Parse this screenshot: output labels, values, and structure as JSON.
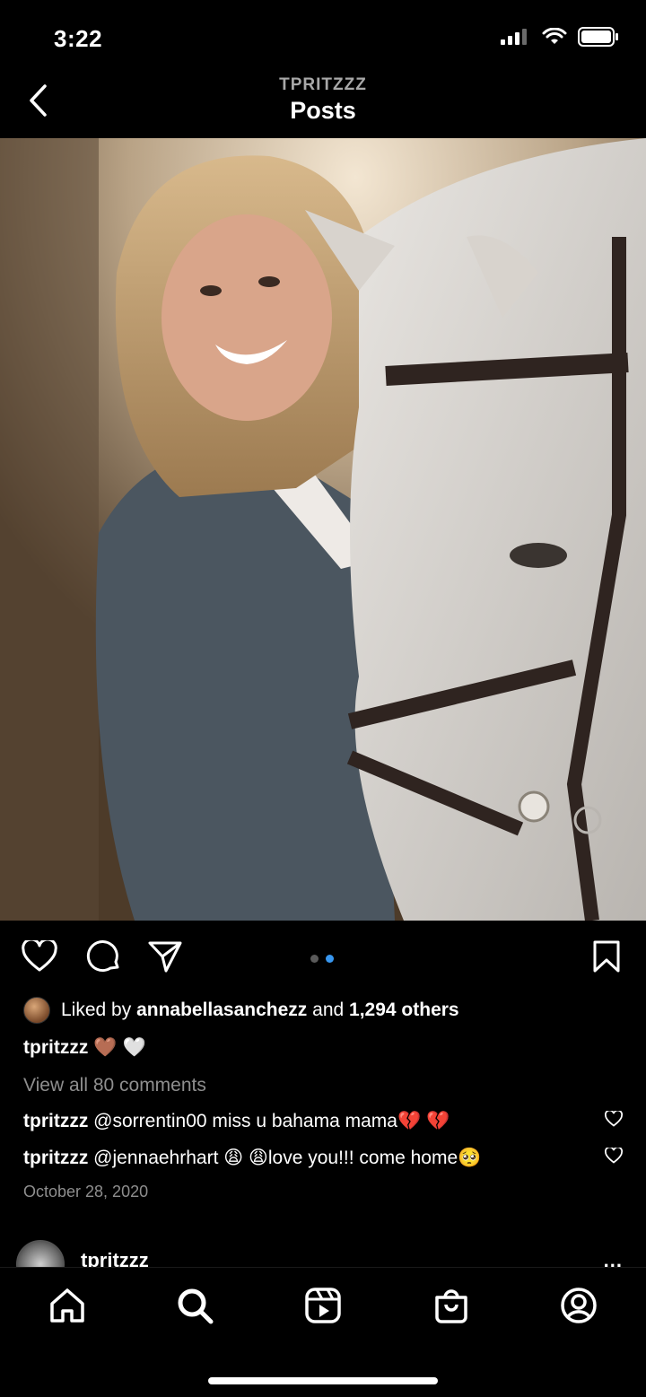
{
  "status_bar": {
    "time": "3:22"
  },
  "header": {
    "username": "TPRITZZZ",
    "title": "Posts"
  },
  "post": {
    "carousel": {
      "count": 2,
      "active_index": 1
    },
    "likes": {
      "prefix": "Liked by",
      "liked_by_user": "annabellasanchezz",
      "and": "and",
      "others": "1,294 others"
    },
    "caption": {
      "username": "tpritzzz",
      "emojis": [
        "🤎",
        "🤍"
      ]
    },
    "view_all_comments": "View all 80 comments",
    "comments": [
      {
        "username": "tpritzzz",
        "text": "@sorrentin00 miss u bahama mama💔 💔"
      },
      {
        "username": "tpritzzz",
        "text": "@jennaehrhart 😩 😩love you!!! come home🥺"
      }
    ],
    "date": "October 28, 2020"
  },
  "next_post": {
    "username": "tpritzzz",
    "more": "..."
  },
  "colors": {
    "accent": "#3897f0",
    "muted": "#8e8e8e",
    "background": "#000000"
  },
  "icons": {
    "actions": [
      "heart-icon",
      "comment-icon",
      "share-icon",
      "bookmark-icon"
    ],
    "tabs": [
      "home-icon",
      "search-icon",
      "reels-icon",
      "shop-icon",
      "profile-icon"
    ]
  }
}
